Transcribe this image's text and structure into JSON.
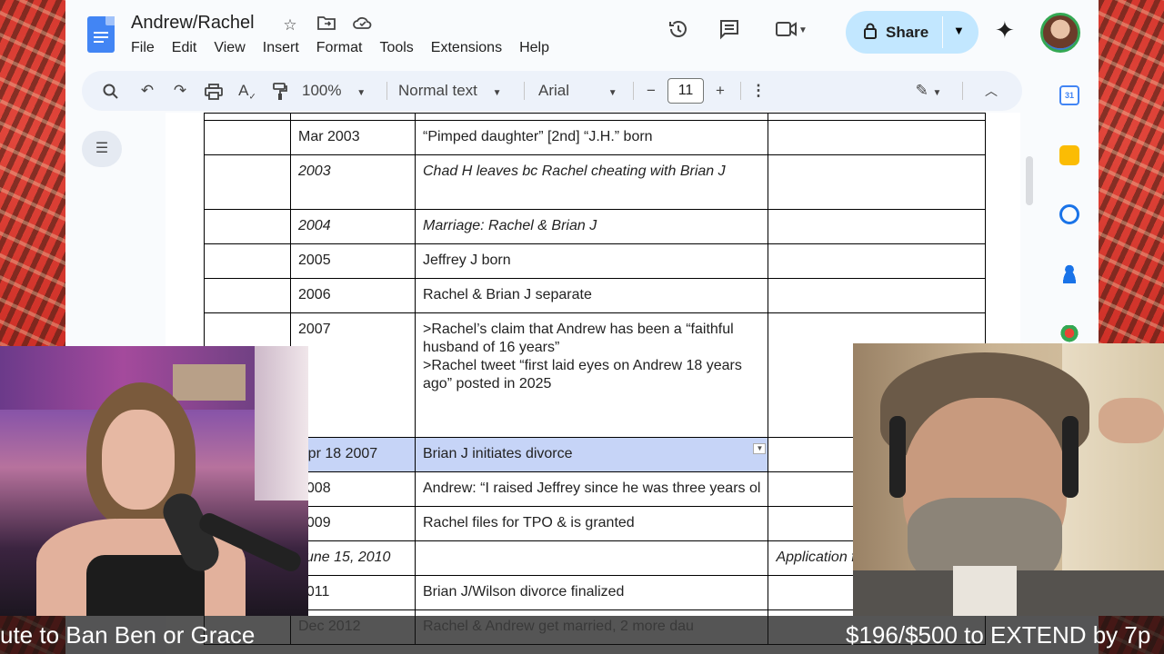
{
  "app": {
    "title": "Andrew/Rachel",
    "menu": [
      "File",
      "Edit",
      "View",
      "Insert",
      "Format",
      "Tools",
      "Extensions",
      "Help"
    ],
    "share_label": "Share"
  },
  "toolbar": {
    "zoom": "100%",
    "style": "Normal text",
    "font": "Arial",
    "font_size": "11",
    "minus": "−",
    "plus": "+"
  },
  "table": {
    "rows": [
      {
        "date": "",
        "event": "",
        "note": "",
        "cut": true
      },
      {
        "date": "Mar 2003",
        "event": "“Pimped daughter” [2nd] “J.H.” born",
        "note": ""
      },
      {
        "date": "2003",
        "event": "Chad H leaves bc Rachel cheating with Brian J",
        "note": "",
        "italic": true
      },
      {
        "date": "2004",
        "event": "Marriage: Rachel & Brian J",
        "note": "",
        "italic": true
      },
      {
        "date": "2005",
        "event": "Jeffrey J born",
        "note": ""
      },
      {
        "date": "2006",
        "event": "Rachel & Brian J separate",
        "note": ""
      },
      {
        "date": "2007",
        "event_lines": [
          ">Rachel’s claim that Andrew has been a “faithful husband of 16 years”",
          ">Rachel tweet “first laid eyes on Andrew 18 years ago” posted in 2025"
        ],
        "note": ""
      },
      {
        "date": "Apr 18 2007",
        "event": "Brian J initiates divorce",
        "note": "",
        "highlight": true
      },
      {
        "date": "2008",
        "event": "Andrew: “I raised Jeffrey since he was three years ol",
        "note": ""
      },
      {
        "date": "2009",
        "event": "Rachel files for TPO & is granted",
        "note": ""
      },
      {
        "date": "June 15, 2010",
        "event": "",
        "note": "Application for",
        "italic": true
      },
      {
        "date": "2011",
        "event": "Brian J/Wilson divorce finalized",
        "note": ""
      },
      {
        "date": "Dec 2012",
        "event": "Rachel & Andrew get married, 2 more dau",
        "note": "",
        "faded": true
      }
    ]
  },
  "ticker": {
    "left": "ute to Ban Ben or Grace",
    "right": "$196/$500 to EXTEND by 7p"
  },
  "icons": {
    "star": "star-icon",
    "folder": "move-to-folder-icon",
    "cloud": "cloud-status-icon",
    "history": "version-history-icon",
    "comment": "comments-icon",
    "meet": "meet-camera-icon",
    "lock": "lock-icon",
    "gemini": "gemini-sparkle-icon"
  },
  "colors": {
    "share_bg": "#c2e7ff",
    "highlight": "#c6d4f7",
    "docs_blue": "#4285f4"
  }
}
